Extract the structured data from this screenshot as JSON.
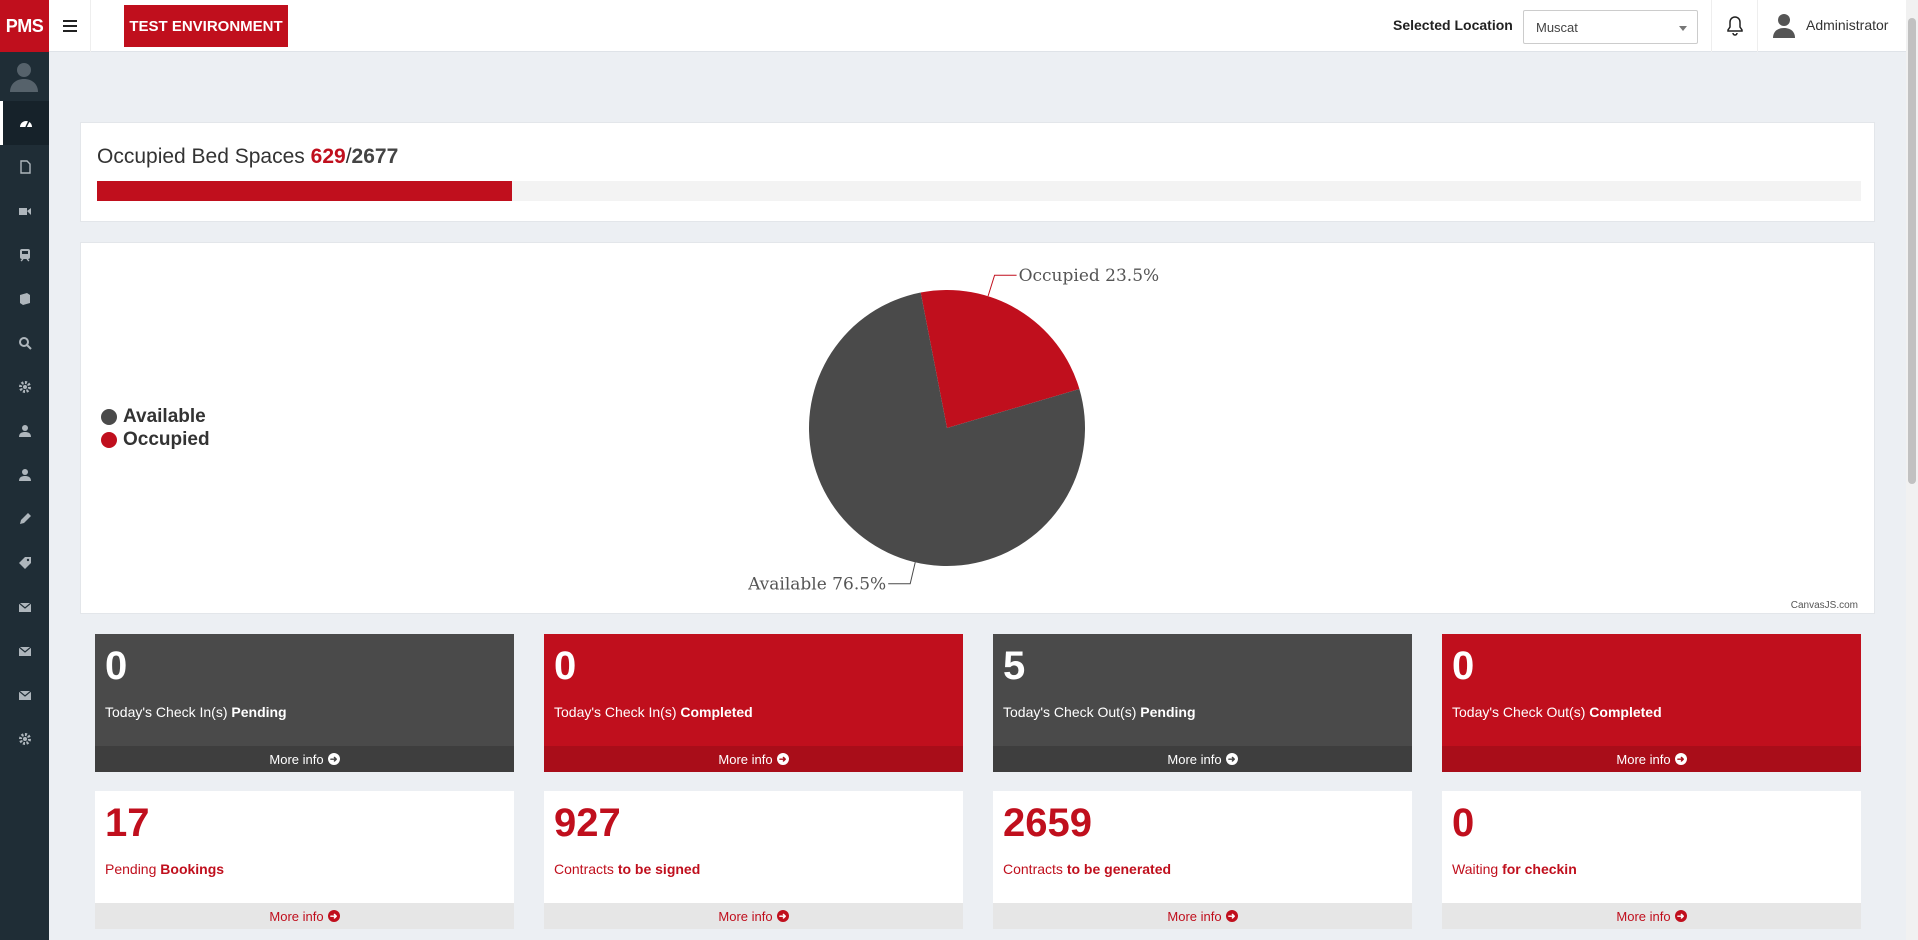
{
  "header": {
    "logo": "PMS",
    "env_badge": "TEST ENVIRONMENT",
    "location_label": "Selected Location",
    "location_value": "Muscat",
    "user_name": "Administrator"
  },
  "sidebar": {
    "items": [
      {
        "icon": "dashboard-icon"
      },
      {
        "icon": "document-icon"
      },
      {
        "icon": "video-icon"
      },
      {
        "icon": "train-icon"
      },
      {
        "icon": "book-icon"
      },
      {
        "icon": "search-icon"
      },
      {
        "icon": "gear-icon"
      },
      {
        "icon": "user-icon"
      },
      {
        "icon": "user-icon"
      },
      {
        "icon": "pencil-icon"
      },
      {
        "icon": "ticket-icon"
      },
      {
        "icon": "envelope-icon"
      },
      {
        "icon": "envelope-icon"
      },
      {
        "icon": "envelope-icon"
      },
      {
        "icon": "gear-icon"
      }
    ]
  },
  "occupancy": {
    "title": "Occupied Bed Spaces",
    "occupied": "629",
    "separator": "/",
    "total": "2677",
    "progress_fraction": 0.235
  },
  "chart_data": {
    "type": "pie",
    "slices": [
      {
        "label": "Available",
        "value": 76.5,
        "color": "#4a4a4a",
        "index_label": "Available 76.5%"
      },
      {
        "label": "Occupied",
        "value": 23.5,
        "color": "#c00f1d",
        "index_label": "Occupied 23.5%"
      }
    ],
    "legend_placement": "left",
    "credit": "CanvasJS.com"
  },
  "stats_row1": [
    {
      "value": "0",
      "pre": "Today's Check In(s) ",
      "bold": "Pending",
      "more": "More info",
      "style": "dark"
    },
    {
      "value": "0",
      "pre": "Today's Check In(s) ",
      "bold": "Completed",
      "more": "More info",
      "style": "red"
    },
    {
      "value": "5",
      "pre": "Today's Check Out(s) ",
      "bold": "Pending",
      "more": "More info",
      "style": "dark"
    },
    {
      "value": "0",
      "pre": "Today's Check Out(s) ",
      "bold": "Completed",
      "more": "More info",
      "style": "red"
    }
  ],
  "stats_row2": [
    {
      "value": "17",
      "pre": "Pending ",
      "bold": "Bookings",
      "more": "More info",
      "style": "white"
    },
    {
      "value": "927",
      "pre": "Contracts ",
      "bold": "to be signed",
      "more": "More info",
      "style": "white"
    },
    {
      "value": "2659",
      "pre": "Contracts ",
      "bold": "to be generated",
      "more": "More info",
      "style": "white"
    },
    {
      "value": "0",
      "pre": "Waiting ",
      "bold": "for checkin",
      "more": "More info",
      "style": "white"
    }
  ],
  "colors": {
    "brand": "#c00f1d",
    "dark": "#4a4a4a",
    "sidebar": "#1f2d36"
  }
}
